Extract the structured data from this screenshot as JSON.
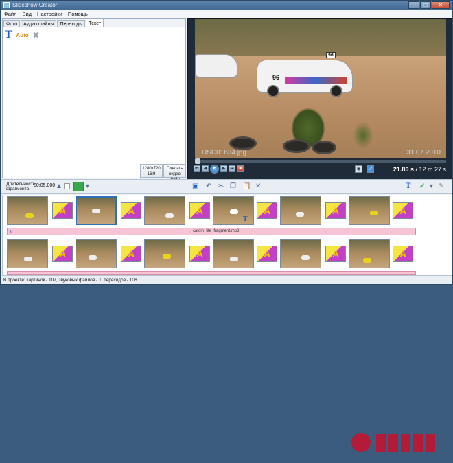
{
  "window": {
    "title": "Slideshow Creator"
  },
  "menu": [
    "Файл",
    "Вид",
    "Настройки",
    "Помощь"
  ],
  "tabs": [
    "Фото",
    "Аудио файлы",
    "Переходы",
    "Текст"
  ],
  "text_panel": {
    "auto_label": "Auto"
  },
  "resolution_button": {
    "line1": "1280x720",
    "line2": "16:9"
  },
  "make_video_button": {
    "line1": "Сделать",
    "line2": "видео файл"
  },
  "preview": {
    "filename": "DSC01634.jpg",
    "date": "31.07.2010",
    "car_number": "96",
    "time_current": "21.80 s",
    "time_total": "/ 12 m 27 s"
  },
  "toolbar": {
    "duration_label": "Длительность фрагмента",
    "duration_value": "00:05,000"
  },
  "timeline": {
    "audio_file": "catoin_life_fragment.mp3"
  },
  "status": {
    "text": "В проекте: картинок - 107, звуковых файлов - 1, переходов - 106"
  },
  "colors": {
    "accent": "#2f6fb8",
    "transition": "#c23fc6",
    "audio": "#f7c4d6"
  }
}
